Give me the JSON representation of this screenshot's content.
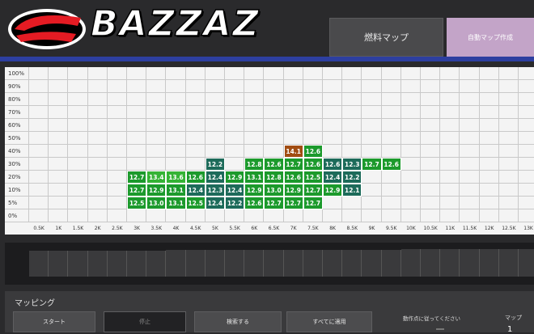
{
  "brand": "BAZZAZ",
  "tabs": {
    "fuel_map": "燃料マップ",
    "auto_map": "自動マップ作成"
  },
  "colors": {
    "accent_bar": "#2d3fa0",
    "green_light": "#35b335",
    "green_mid": "#1c9a2c",
    "teal": "#1d6b5a",
    "orange": "#a14d12"
  },
  "grid": {
    "y_labels": [
      "100%",
      "90%",
      "80%",
      "70%",
      "60%",
      "50%",
      "40%",
      "30%",
      "20%",
      "10%",
      "5%",
      "0%"
    ],
    "x_labels": [
      "0.5K",
      "1K",
      "1.5K",
      "2K",
      "2.5K",
      "3K",
      "3.5K",
      "4K",
      "4.5K",
      "5K",
      "5.5K",
      "6K",
      "6.5K",
      "7K",
      "7.5K",
      "8K",
      "8.5K",
      "9K",
      "9.5K",
      "10K",
      "10.5K",
      "11K",
      "11.5K",
      "12K",
      "12.5K",
      "13K"
    ],
    "cells": [
      {
        "row": 6,
        "col": 13,
        "v": "14.1",
        "c": "orange"
      },
      {
        "row": 6,
        "col": 14,
        "v": "12.6",
        "c": "green_mid"
      },
      {
        "row": 7,
        "col": 9,
        "v": "12.2",
        "c": "teal"
      },
      {
        "row": 7,
        "col": 11,
        "v": "12.8",
        "c": "green_mid"
      },
      {
        "row": 7,
        "col": 12,
        "v": "12.6",
        "c": "green_mid"
      },
      {
        "row": 7,
        "col": 13,
        "v": "12.7",
        "c": "green_mid"
      },
      {
        "row": 7,
        "col": 14,
        "v": "12.6",
        "c": "green_mid"
      },
      {
        "row": 7,
        "col": 15,
        "v": "12.6",
        "c": "teal"
      },
      {
        "row": 7,
        "col": 16,
        "v": "12.3",
        "c": "teal"
      },
      {
        "row": 7,
        "col": 17,
        "v": "12.7",
        "c": "green_mid"
      },
      {
        "row": 7,
        "col": 18,
        "v": "12.6",
        "c": "green_mid"
      },
      {
        "row": 8,
        "col": 5,
        "v": "12.7",
        "c": "green_mid"
      },
      {
        "row": 8,
        "col": 6,
        "v": "13.4",
        "c": "green_light"
      },
      {
        "row": 8,
        "col": 7,
        "v": "13.6",
        "c": "green_light"
      },
      {
        "row": 8,
        "col": 8,
        "v": "12.6",
        "c": "green_mid"
      },
      {
        "row": 8,
        "col": 9,
        "v": "12.4",
        "c": "teal"
      },
      {
        "row": 8,
        "col": 10,
        "v": "12.9",
        "c": "green_mid"
      },
      {
        "row": 8,
        "col": 11,
        "v": "13.1",
        "c": "green_mid"
      },
      {
        "row": 8,
        "col": 12,
        "v": "12.8",
        "c": "green_mid"
      },
      {
        "row": 8,
        "col": 13,
        "v": "12.6",
        "c": "green_mid"
      },
      {
        "row": 8,
        "col": 14,
        "v": "12.5",
        "c": "green_mid"
      },
      {
        "row": 8,
        "col": 15,
        "v": "12.4",
        "c": "teal"
      },
      {
        "row": 8,
        "col": 16,
        "v": "12.2",
        "c": "teal"
      },
      {
        "row": 9,
        "col": 5,
        "v": "12.7",
        "c": "green_mid"
      },
      {
        "row": 9,
        "col": 6,
        "v": "12.9",
        "c": "green_mid"
      },
      {
        "row": 9,
        "col": 7,
        "v": "13.1",
        "c": "green_mid"
      },
      {
        "row": 9,
        "col": 8,
        "v": "12.4",
        "c": "teal"
      },
      {
        "row": 9,
        "col": 9,
        "v": "12.3",
        "c": "teal"
      },
      {
        "row": 9,
        "col": 10,
        "v": "12.4",
        "c": "teal"
      },
      {
        "row": 9,
        "col": 11,
        "v": "12.9",
        "c": "green_mid"
      },
      {
        "row": 9,
        "col": 12,
        "v": "13.0",
        "c": "green_mid"
      },
      {
        "row": 9,
        "col": 13,
        "v": "12.9",
        "c": "green_mid"
      },
      {
        "row": 9,
        "col": 14,
        "v": "12.7",
        "c": "green_mid"
      },
      {
        "row": 9,
        "col": 15,
        "v": "12.9",
        "c": "green_mid"
      },
      {
        "row": 9,
        "col": 16,
        "v": "12.1",
        "c": "teal"
      },
      {
        "row": 10,
        "col": 5,
        "v": "12.5",
        "c": "green_mid"
      },
      {
        "row": 10,
        "col": 6,
        "v": "13.0",
        "c": "green_mid"
      },
      {
        "row": 10,
        "col": 7,
        "v": "13.1",
        "c": "green_mid"
      },
      {
        "row": 10,
        "col": 8,
        "v": "12.5",
        "c": "green_mid"
      },
      {
        "row": 10,
        "col": 9,
        "v": "12.4",
        "c": "teal"
      },
      {
        "row": 10,
        "col": 10,
        "v": "12.2",
        "c": "teal"
      },
      {
        "row": 10,
        "col": 11,
        "v": "12.6",
        "c": "green_mid"
      },
      {
        "row": 10,
        "col": 12,
        "v": "12.7",
        "c": "green_mid"
      },
      {
        "row": 10,
        "col": 13,
        "v": "12.7",
        "c": "green_mid"
      },
      {
        "row": 10,
        "col": 14,
        "v": "12.7",
        "c": "green_mid"
      }
    ]
  },
  "slider": {
    "bars": 26
  },
  "panel": {
    "title": "マッピング",
    "start": "スタート",
    "stop": "停止",
    "search": "検索する",
    "apply_all": "すべてに適用",
    "hint": "動作点に従ってください",
    "map_label": "マップ",
    "map_value": "1"
  }
}
